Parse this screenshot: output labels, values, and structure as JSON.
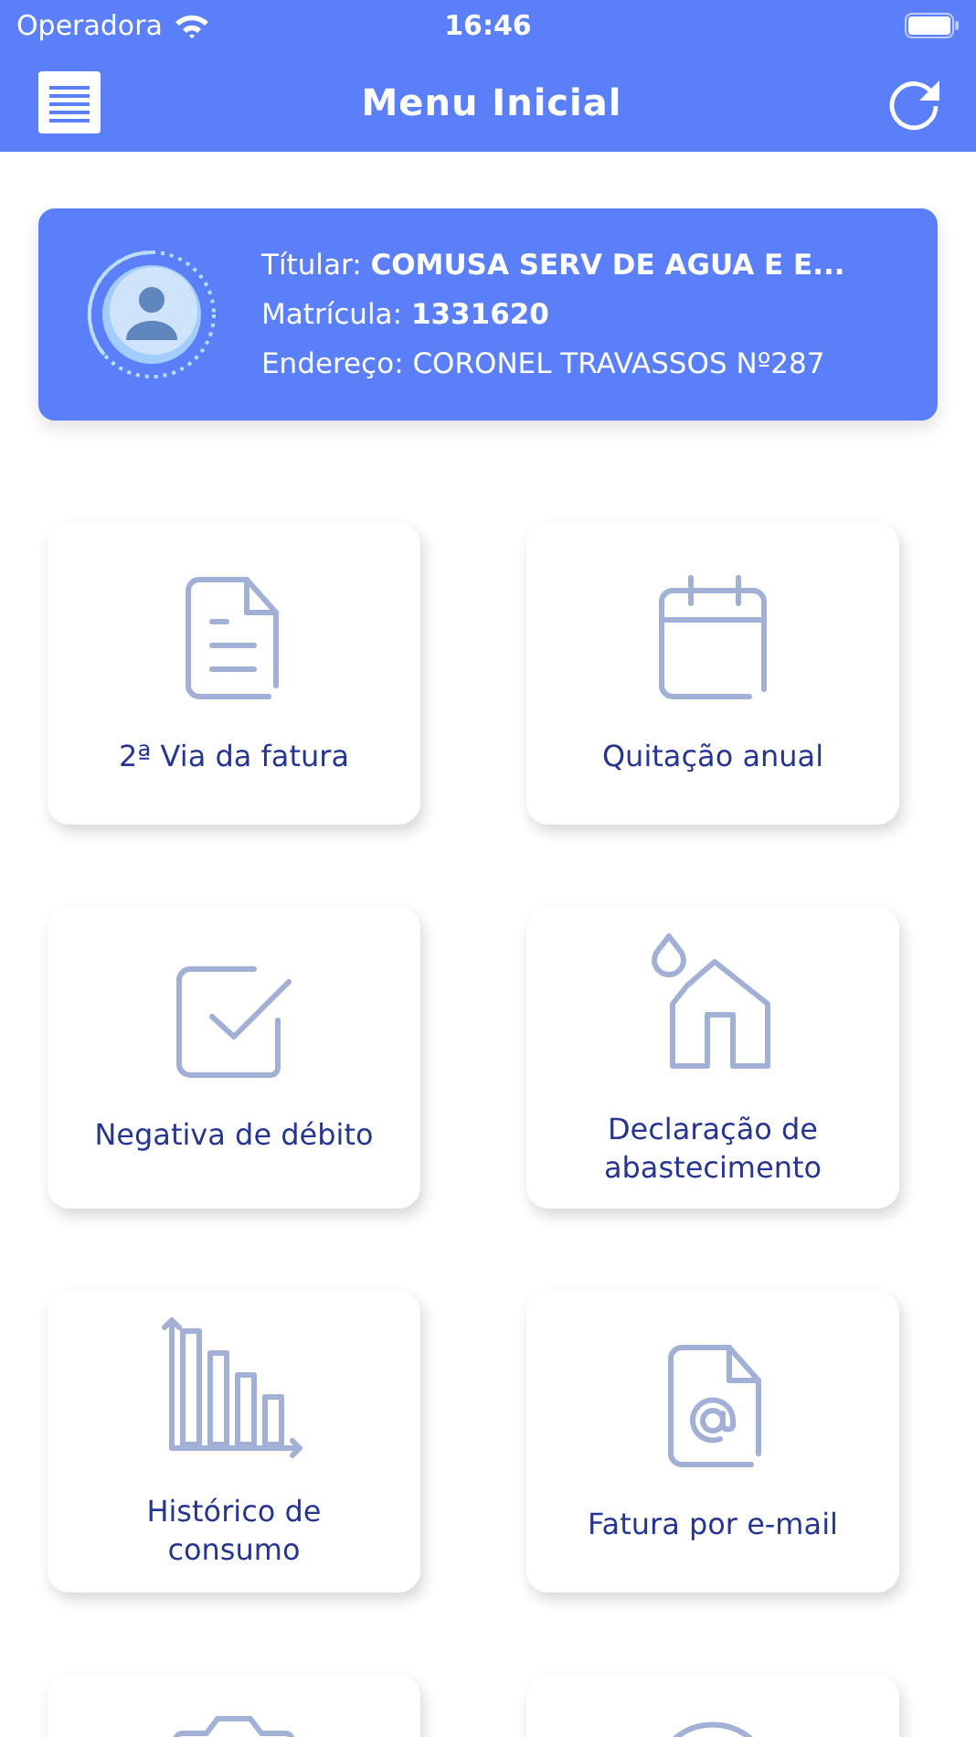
{
  "status_bar": {
    "carrier": "Operadora",
    "time": "16:46"
  },
  "header": {
    "title": "Menu Inicial"
  },
  "account": {
    "holder": "Títular: **COMUSA SERV DE AGUA E E...**",
    "registration": "Matrícula: **1331620**",
    "address": "Endereço: CORONEL TRAVASSOS Nº287"
  },
  "tiles": [
    {
      "kind": "invoice",
      "label": "2ª Via da fatura"
    },
    {
      "kind": "calendar",
      "label": "Quitação anual"
    },
    {
      "kind": "check",
      "label": "Negativa de débito"
    },
    {
      "kind": "house",
      "label": "Declaração de abastecimento"
    },
    {
      "kind": "chart",
      "label": "Histórico de consumo"
    },
    {
      "kind": "email",
      "label": "Fatura por e-mail"
    },
    {
      "kind": "camera"
    },
    {
      "kind": "circle"
    }
  ]
}
